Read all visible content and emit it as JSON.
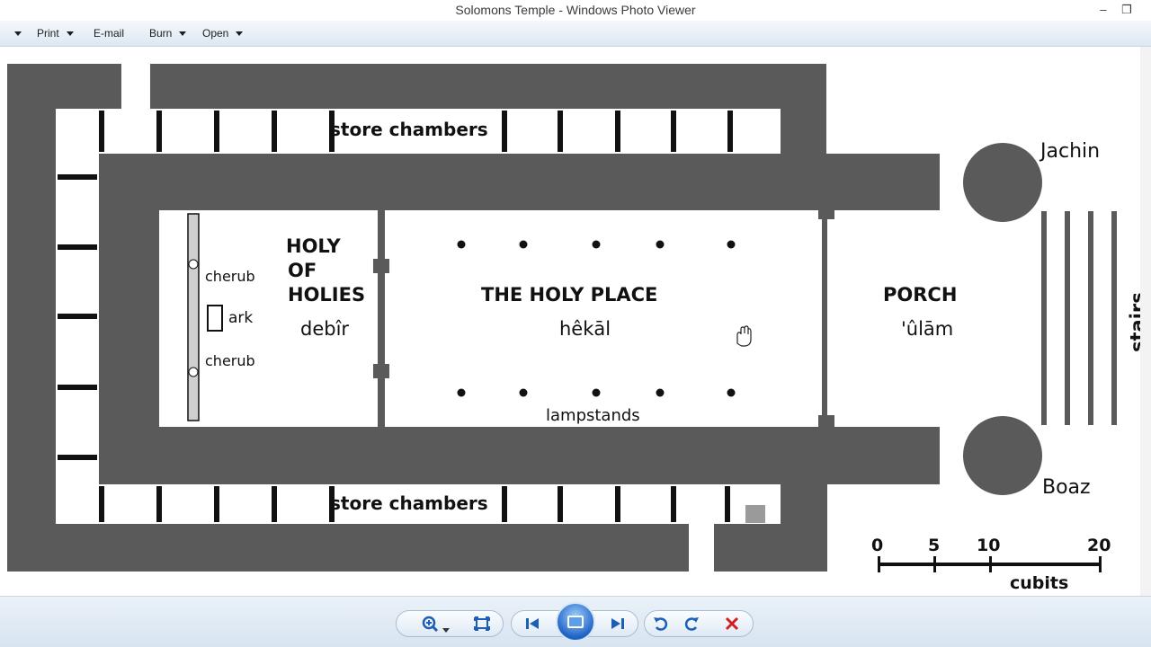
{
  "window": {
    "title": "Solomons Temple - Windows Photo Viewer",
    "minimize": "–",
    "restore": "❐"
  },
  "menu": {
    "file_label": "",
    "print": "Print",
    "email": "E-mail",
    "burn": "Burn",
    "open": "Open"
  },
  "image": {
    "labels": {
      "store_top": "store chambers",
      "store_bottom": "store chambers",
      "holy_of_holies_1": "HOLY",
      "holy_of_holies_2": "OF",
      "holy_of_holies_3": "HOLIES",
      "debir": "debîr",
      "holy_place": "THE HOLY PLACE",
      "hekal": "hêkāl",
      "porch": "PORCH",
      "ulam": "'ûlām",
      "cherub_top": "cherub",
      "ark": "ark",
      "cherub_bottom": "cherub",
      "lampstands": "lampstands",
      "jachin": "Jachin",
      "boaz": "Boaz",
      "stairs": "stairs",
      "cubits": "cubits"
    },
    "scale_ticks": [
      "0",
      "5",
      "10",
      "20"
    ],
    "colors": {
      "wall": "#5a5a5a",
      "ink": "#111111"
    }
  },
  "controls": {
    "zoom": "zoom-icon",
    "actual_size": "fit-icon",
    "previous": "previous-icon",
    "slideshow": "slideshow-icon",
    "next": "next-icon",
    "rotate_ccw": "rotate-ccw-icon",
    "rotate_cw": "rotate-cw-icon",
    "delete": "delete-icon"
  }
}
